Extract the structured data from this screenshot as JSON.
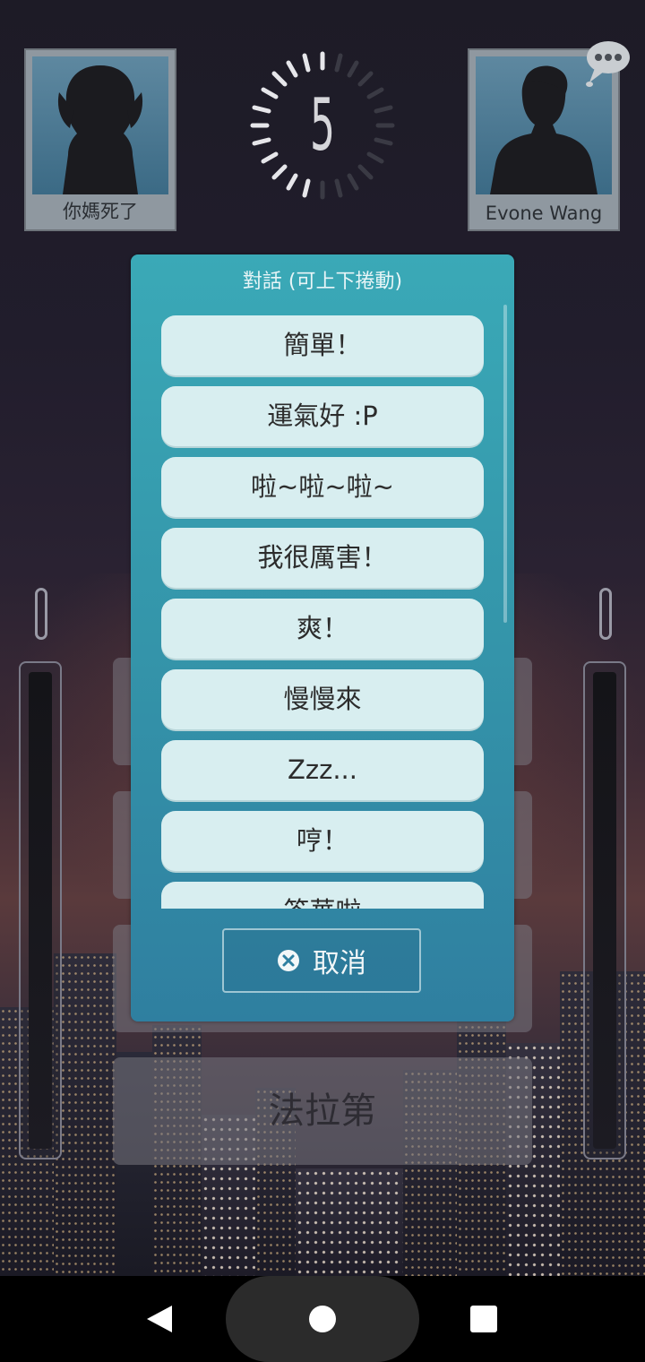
{
  "players": {
    "left": {
      "name": "你媽死了"
    },
    "right": {
      "name": "Evone  Wang"
    }
  },
  "timer": {
    "value": "5"
  },
  "answers": [
    {
      "label": ""
    },
    {
      "label": ""
    },
    {
      "label": ""
    },
    {
      "label": "法拉第"
    }
  ],
  "dialog": {
    "title": "對話 (可上下捲動)",
    "options": [
      "簡單！",
      "運氣好 :P",
      "啦~啦~啦~",
      "我很厲害！",
      "爽！",
      "慢慢來",
      "Zzz...",
      "哼！",
      "答華啦"
    ],
    "cancel_label": "取消"
  },
  "colors": {
    "dialog_top": "#3aa9b7",
    "dialog_bottom": "#2f7fa0",
    "option_bg": "#d8eef0"
  }
}
